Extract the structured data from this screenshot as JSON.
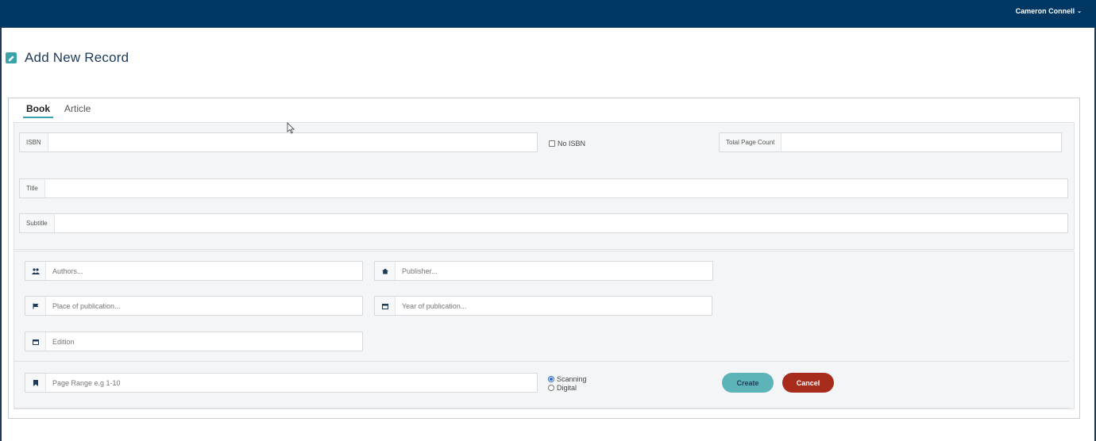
{
  "header": {
    "user_name": "Cameron Connell",
    "chevron": "⌄"
  },
  "page": {
    "title": "Add New Record"
  },
  "tabs": [
    {
      "label": "Book",
      "active": true
    },
    {
      "label": "Article",
      "active": false
    }
  ],
  "fields": {
    "isbn": {
      "label": "ISBN",
      "value": ""
    },
    "no_isbn": {
      "label": "No ISBN",
      "checked": false
    },
    "total_page_count": {
      "label": "Total Page Count",
      "value": ""
    },
    "title": {
      "label": "Title",
      "value": ""
    },
    "subtitle": {
      "label": "Subtitle",
      "value": ""
    },
    "authors": {
      "placeholder": "Authors...",
      "icon": "users-icon"
    },
    "publisher": {
      "placeholder": "Publisher...",
      "icon": "home-icon"
    },
    "place_of_publication": {
      "placeholder": "Place of publication...",
      "icon": "flag-icon"
    },
    "year_of_publication": {
      "placeholder": "Year of publication...",
      "icon": "calendar-icon"
    },
    "edition": {
      "placeholder": "Edition",
      "icon": "calendar-icon"
    },
    "page_range": {
      "placeholder": "Page Range e.g 1-10",
      "icon": "bookmark-icon"
    }
  },
  "mode": {
    "options": [
      "Scanning",
      "Digital"
    ],
    "selected": "Scanning"
  },
  "actions": {
    "create_label": "Create",
    "cancel_label": "Cancel"
  },
  "colors": {
    "header_bg": "#003763",
    "accent": "#3aa3a9",
    "create_bg": "#5db4b8",
    "cancel_bg": "#a82c1c"
  }
}
